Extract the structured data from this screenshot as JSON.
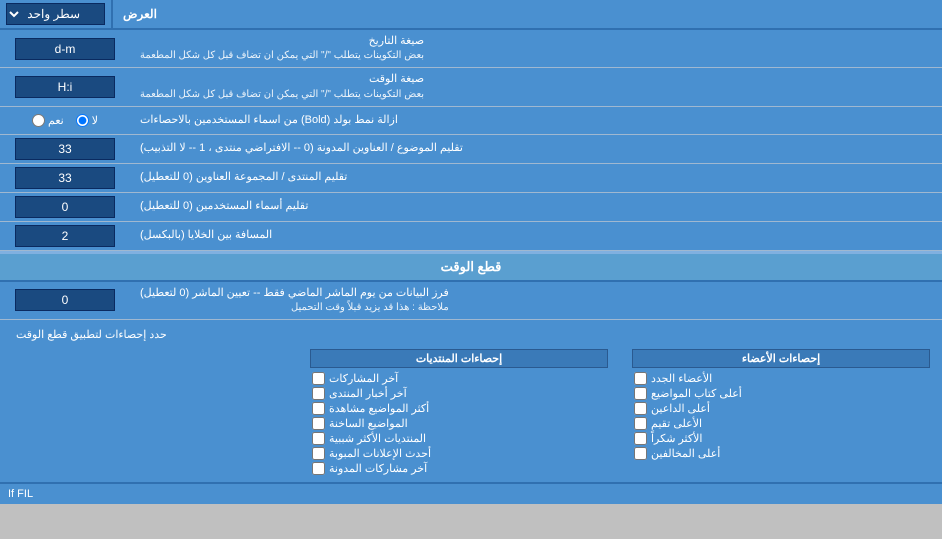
{
  "header": {
    "title": "العرض",
    "dropdown_label": "سطر واحد"
  },
  "rows": [
    {
      "id": "date_format",
      "label": "صيغة التاريخ",
      "sublabel": "بعض التكوينات يتطلب \"/\" التي يمكن ان تضاف قبل كل شكل المطعمة",
      "value": "d-m"
    },
    {
      "id": "time_format",
      "label": "صيغة الوقت",
      "sublabel": "بعض التكوينات يتطلب \"/\" التي يمكن ان تضاف قبل كل شكل المطعمة",
      "value": "H:i"
    },
    {
      "id": "bold_remove",
      "label": "ازالة نمط بولد (Bold) من اسماء المستخدمين بالاحصاءات",
      "radio_yes": "نعم",
      "radio_no": "لا",
      "selected": "no"
    },
    {
      "id": "topic_address",
      "label": "تقليم الموضوع / العناوين المدونة (0 -- الافتراضي منتدى ، 1 -- لا التذبيب)",
      "value": "33"
    },
    {
      "id": "forum_address",
      "label": "تقليم المنتدى / المجموعة العناوين (0 للتعطيل)",
      "value": "33"
    },
    {
      "id": "usernames_trim",
      "label": "تقليم أسماء المستخدمين (0 للتعطيل)",
      "value": "0"
    },
    {
      "id": "cell_spacing",
      "label": "المسافة بين الخلايا (بالبكسل)",
      "value": "2"
    }
  ],
  "cutoff_section": {
    "title": "قطع الوقت",
    "row": {
      "label": "فرز البيانات من يوم الماشر الماضي فقط -- تعيين الماشر (0 لتعطيل)",
      "note": "ملاحظة : هذا قد يزيد قبلاً وقت التحميل",
      "value": "0"
    },
    "limit_label": "حدد إحصاءات لتطبيق قطع الوقت"
  },
  "checkboxes": {
    "col1_title": "إحصاءات الأعضاء",
    "col1_items": [
      "الأعضاء الجدد",
      "أعلى كتاب المواضيع",
      "أعلى الداعين",
      "الأعلى تقيم",
      "الأكثر شكراً",
      "أعلى المخالفين"
    ],
    "col2_title": "إحصاءات المنتديات",
    "col2_items": [
      "آخر المشاركات",
      "آخر أخبار المنتدى",
      "أكثر المواضيع مشاهدة",
      "المواضيع الساخنة",
      "المنتديات الأكثر شببية",
      "أحدث الإعلانات المبوبة",
      "آخر مشاركات المدونة"
    ]
  },
  "footer_text": "If FIL"
}
